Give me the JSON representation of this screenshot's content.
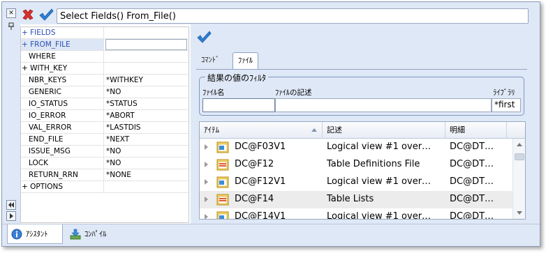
{
  "command": {
    "text": "Select Fields() From_File()",
    "cancel_icon": "red-x-icon",
    "ok_icon": "blue-check-icon"
  },
  "side_buttons": {
    "close": "✕",
    "pin": "📌",
    "scroll_first": "◀◀",
    "scroll_next": "▶"
  },
  "properties": [
    {
      "name": "+ FIELDS",
      "value": "",
      "category": true,
      "blue": true
    },
    {
      "name": "+ FROM_FILE",
      "value": "",
      "category": true,
      "blue": true,
      "selected": true
    },
    {
      "name": "WHERE",
      "value": ""
    },
    {
      "name": "+ WITH_KEY",
      "value": "",
      "category": true
    },
    {
      "name": "NBR_KEYS",
      "value": "*WITHKEY"
    },
    {
      "name": "GENERIC",
      "value": "*NO"
    },
    {
      "name": "IO_STATUS",
      "value": "*STATUS"
    },
    {
      "name": "IO_ERROR",
      "value": "*ABORT"
    },
    {
      "name": "VAL_ERROR",
      "value": "*LASTDIS"
    },
    {
      "name": "END_FILE",
      "value": "*NEXT"
    },
    {
      "name": "ISSUE_MSG",
      "value": "*NO"
    },
    {
      "name": "LOCK",
      "value": "*NO"
    },
    {
      "name": "RETURN_RRN",
      "value": "*NONE"
    },
    {
      "name": "+ OPTIONS",
      "value": "",
      "category": true
    }
  ],
  "tabs": {
    "command": "ｺﾏﾝﾄﾞ",
    "file": "ﾌｧｲﾙ"
  },
  "filter": {
    "legend": "結果の値のﾌｨﾙﾀ",
    "file_name_label": "ﾌｧｲﾙ名",
    "file_desc_label": "ﾌｧｲﾙの記述",
    "library_label": "ﾗｲﾌﾞﾗﾘ",
    "file_name_value": "",
    "file_desc_value": "",
    "library_value": "*first"
  },
  "list": {
    "headers": [
      "ｱｲﾃﾑ",
      "記述",
      "明細"
    ],
    "rows": [
      {
        "item": "DC@F03V1",
        "desc": "Logical view #1 over…",
        "detail": "DC@DT…",
        "icon": "view"
      },
      {
        "item": "DC@F12",
        "desc": "Table Definitions File",
        "detail": "DC@DT…",
        "icon": "table"
      },
      {
        "item": "DC@F12V1",
        "desc": "Logical view #1 over…",
        "detail": "DC@DT…",
        "icon": "view"
      },
      {
        "item": "DC@F14",
        "desc": "Table Lists",
        "detail": "DC@DT…",
        "icon": "table",
        "selected": true
      },
      {
        "item": "DC@F14V1",
        "desc": "Logical view #1 over…",
        "detail": "DC@DT…",
        "icon": "view"
      }
    ]
  },
  "bottom_tabs": {
    "assistant": "ｱｼｽﾀﾝﾄ",
    "compile": "ｺﾝﾊﾟｲﾙ"
  },
  "colors": {
    "panel_bg": "#dfe8f6",
    "blue_text": "#2a4fb5",
    "check_blue": "#2f7fd6",
    "cancel_red": "#d93030"
  }
}
